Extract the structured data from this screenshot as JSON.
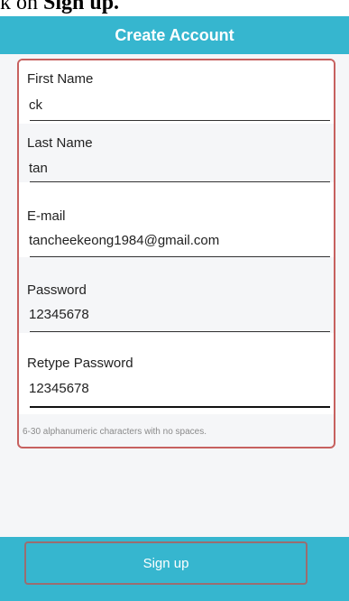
{
  "caption": {
    "prefix": "k on ",
    "bold": "Sign up."
  },
  "header": {
    "title": "Create Account"
  },
  "form": {
    "fields": [
      {
        "label": "First Name",
        "value": "ck"
      },
      {
        "label": "Last Name",
        "value": "tan"
      },
      {
        "label": "E-mail",
        "value": "tancheekeong1984@gmail.com"
      },
      {
        "label": "Password",
        "value": "12345678"
      },
      {
        "label": "Retype Password",
        "value": "12345678"
      }
    ],
    "hint": "6-30 alphanumeric characters with no spaces."
  },
  "footer": {
    "signup_label": "Sign up"
  },
  "colors": {
    "header_bg": "#36b6cf",
    "annotation_border": "#c7615f"
  }
}
